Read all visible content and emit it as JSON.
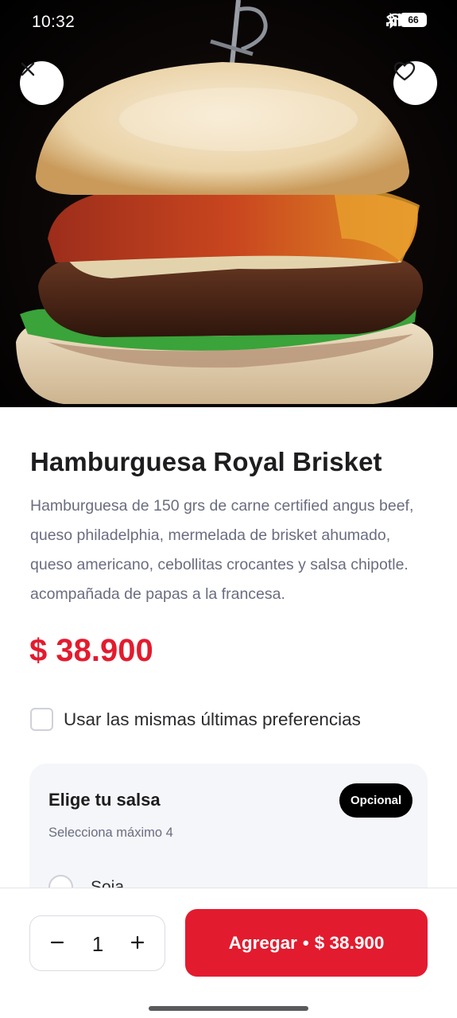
{
  "status_bar": {
    "time": "10:32",
    "battery": "66"
  },
  "product": {
    "name": "Hamburguesa Royal Brisket",
    "description": "Hamburguesa de 150 grs de carne certified angus beef, queso philadelphia, mermelada de brisket ahumado, queso americano, cebollitas crocantes y salsa chipotle. acompañada de papas a la francesa.",
    "price": "$ 38.900"
  },
  "preferences": {
    "label": "Usar las mismas últimas preferencias",
    "checked": false
  },
  "sauce_section": {
    "title": "Elige tu salsa",
    "badge": "Opcional",
    "subtitle": "Selecciona máximo 4",
    "options": [
      {
        "label": "Soja"
      }
    ]
  },
  "footer": {
    "quantity": "1",
    "add_label": "Agregar",
    "separator": "•",
    "add_price": "$ 38.900"
  },
  "colors": {
    "accent": "#e31b2e",
    "badge_bg": "#000000",
    "muted_text": "#6a6d80",
    "card_bg": "#f5f6f9"
  },
  "icons": {
    "close": "close-icon",
    "favorite": "heart-icon",
    "minus": "minus-icon",
    "plus": "plus-icon"
  }
}
